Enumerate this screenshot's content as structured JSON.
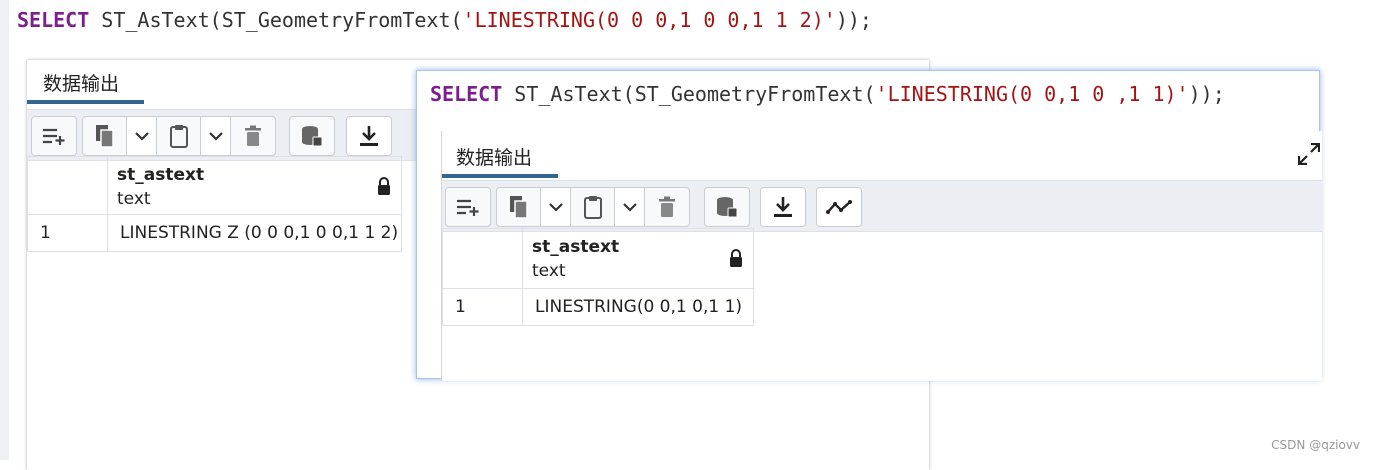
{
  "editor_back": {
    "sql_keyword": "SELECT",
    "sql_func": " ST_AsText(ST_GeometryFromText(",
    "sql_string": "'LINESTRING(0 0 0,1 0 0,1 1 2)'",
    "sql_end": "));"
  },
  "editor_front": {
    "sql_keyword": "SELECT",
    "sql_func": " ST_AsText(ST_GeometryFromText(",
    "sql_string": "'LINESTRING(0 0,1 0 ,1 1)'",
    "sql_end": "));"
  },
  "output_back": {
    "tab_label": "数据输出",
    "column": {
      "name": "st_astext",
      "type": "text"
    },
    "rows": [
      {
        "num": "1",
        "value": "LINESTRING Z (0 0 0,1 0 0,1 1 2)"
      }
    ]
  },
  "output_front": {
    "tab_label": "数据输出",
    "column": {
      "name": "st_astext",
      "type": "text"
    },
    "rows": [
      {
        "num": "1",
        "value": "LINESTRING(0 0,1 0,1 1)"
      }
    ]
  },
  "watermark": "CSDN @qziovv",
  "icons": [
    "add-row-icon",
    "copy-icon",
    "chevron-down-icon",
    "paste-icon",
    "delete-icon",
    "save-data-icon",
    "download-icon",
    "graph-icon",
    "lock-icon",
    "expand-icon"
  ],
  "colors": {
    "keyword": "#7a1f8c",
    "string": "#a31515",
    "tab_accent": "#326690",
    "toolbar_bg": "#ebeef3"
  }
}
